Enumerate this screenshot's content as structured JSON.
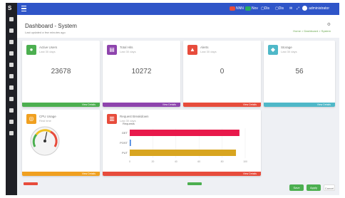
{
  "topbar": {
    "items": [
      {
        "label": "NNN",
        "color": "#e74c3c"
      },
      {
        "label": "Nov",
        "color": "#27ae60"
      },
      {
        "label": "Dis",
        "color": "#2c3e50"
      },
      {
        "label": "Dis",
        "color": "#2c3e50"
      }
    ],
    "user": "administrator"
  },
  "header": {
    "title": "Dashboard - System",
    "subtitle": "Last updated a few minutes ago",
    "breadcrumb": "Home > Dashboard > System",
    "icon": "settings-icon"
  },
  "cards": [
    {
      "title": "Active Users",
      "sub": "Last 30 days",
      "value": "23678",
      "footer": "View Details",
      "color": "#4caf50",
      "icon": "user-icon"
    },
    {
      "title": "Total Hits",
      "sub": "Last 30 days",
      "value": "10272",
      "footer": "View Details",
      "color": "#8e44ad",
      "icon": "chart-icon"
    },
    {
      "title": "Alerts",
      "sub": "Last 30 days",
      "value": "0",
      "footer": "View Details",
      "color": "#e74c3c",
      "icon": "alert-icon"
    },
    {
      "title": "Storage",
      "sub": "Last 30 days",
      "value": "56",
      "footer": "View Details",
      "color": "#4fb8c8",
      "icon": "storage-icon"
    },
    {
      "title": "CPU Usage",
      "sub": "Real time",
      "footer": "View Details",
      "color": "#f0a020",
      "icon": "gauge-icon",
      "gauge_level": 0.55
    },
    {
      "title": "Request Breakdown",
      "sub": "Last 30 days",
      "footer": "View Details",
      "color": "#e74c3c",
      "icon": "bar-icon"
    }
  ],
  "chart_data": {
    "type": "bar",
    "orientation": "horizontal",
    "categories": [
      "GET",
      "POST",
      "PUT"
    ],
    "values": [
      95,
      1,
      92
    ],
    "colors": [
      "#e8194b",
      "#3b7ddd",
      "#d8a520"
    ],
    "xlim": [
      0,
      100
    ],
    "title": "Requests"
  },
  "buttons": {
    "primary": "Save",
    "secondary": "Apply",
    "tertiary": "Cancel"
  }
}
